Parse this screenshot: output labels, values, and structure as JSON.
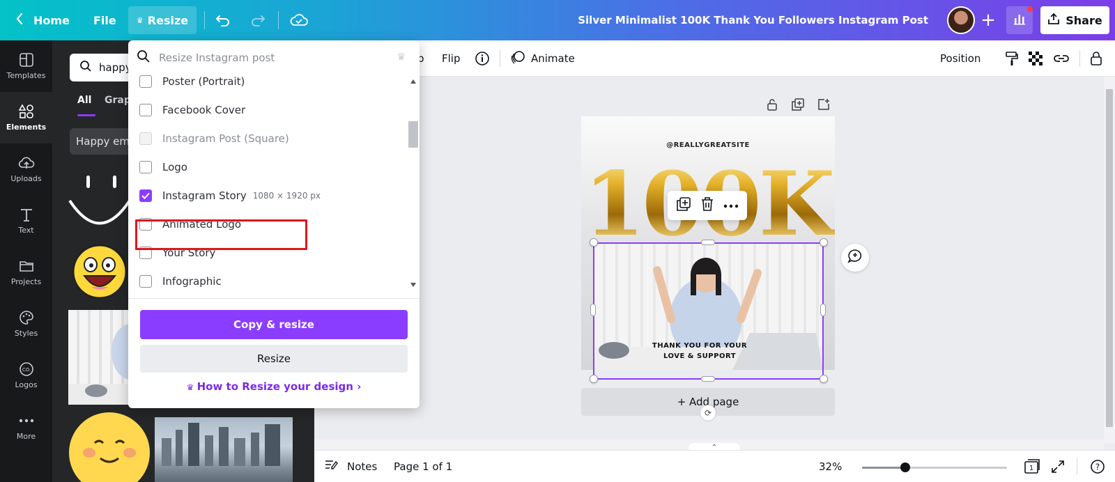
{
  "topbar": {
    "home_label": "Home",
    "file_label": "File",
    "resize_label": "Resize",
    "doc_title": "Silver Minimalist 100K Thank You Followers Instagram Post",
    "share_label": "Share",
    "gradient_start": "#03c2c8",
    "gradient_end": "#7b3ee8"
  },
  "rail": {
    "items": [
      {
        "label": "Templates",
        "icon": "templates-icon"
      },
      {
        "label": "Elements",
        "icon": "elements-icon",
        "active": true
      },
      {
        "label": "Uploads",
        "icon": "upload-cloud-icon"
      },
      {
        "label": "Text",
        "icon": "text-icon"
      },
      {
        "label": "Projects",
        "icon": "folder-icon"
      },
      {
        "label": "Styles",
        "icon": "palette-icon"
      },
      {
        "label": "Logos",
        "icon": "logo-icon"
      },
      {
        "label": "More",
        "icon": "more-dots-icon"
      }
    ]
  },
  "panel": {
    "search_value": "happy",
    "tabs": [
      "All",
      "Grap"
    ],
    "chip": "Happy emo"
  },
  "resize_dropdown": {
    "search_placeholder": "Resize Instagram post",
    "options": [
      {
        "label": "Poster (Portrait)",
        "checked": false,
        "disabled": false
      },
      {
        "label": "Facebook Cover",
        "checked": false,
        "disabled": false
      },
      {
        "label": "Instagram Post (Square)",
        "checked": false,
        "disabled": true
      },
      {
        "label": "Logo",
        "checked": false,
        "disabled": false
      },
      {
        "label": "Instagram Story",
        "checked": true,
        "disabled": false,
        "dimensions": "1080 × 1920 px"
      },
      {
        "label": "Animated Logo",
        "checked": false,
        "disabled": false
      },
      {
        "label": "Your Story",
        "checked": false,
        "disabled": false
      },
      {
        "label": "Infographic",
        "checked": false,
        "disabled": false
      }
    ],
    "copy_resize_label": "Copy & resize",
    "resize_label": "Resize",
    "help_link": "How to Resize your design",
    "accent": "#8b3dff"
  },
  "context_toolbar": {
    "crop_fragment": "p",
    "flip_label": "Flip",
    "animate_label": "Animate",
    "position_label": "Position"
  },
  "design": {
    "handle": "@REALLYGREATSITE",
    "headline": "100K",
    "thanks_line1": "THANK YOU FOR YOUR",
    "thanks_line2": "LOVE & SUPPORT"
  },
  "canvas": {
    "add_page_label": "+ Add page"
  },
  "bottombar": {
    "notes_label": "Notes",
    "page_info": "Page 1 of 1",
    "zoom": "32%",
    "zoom_fraction": 0.3,
    "page_count": "1",
    "help_label": "?"
  }
}
